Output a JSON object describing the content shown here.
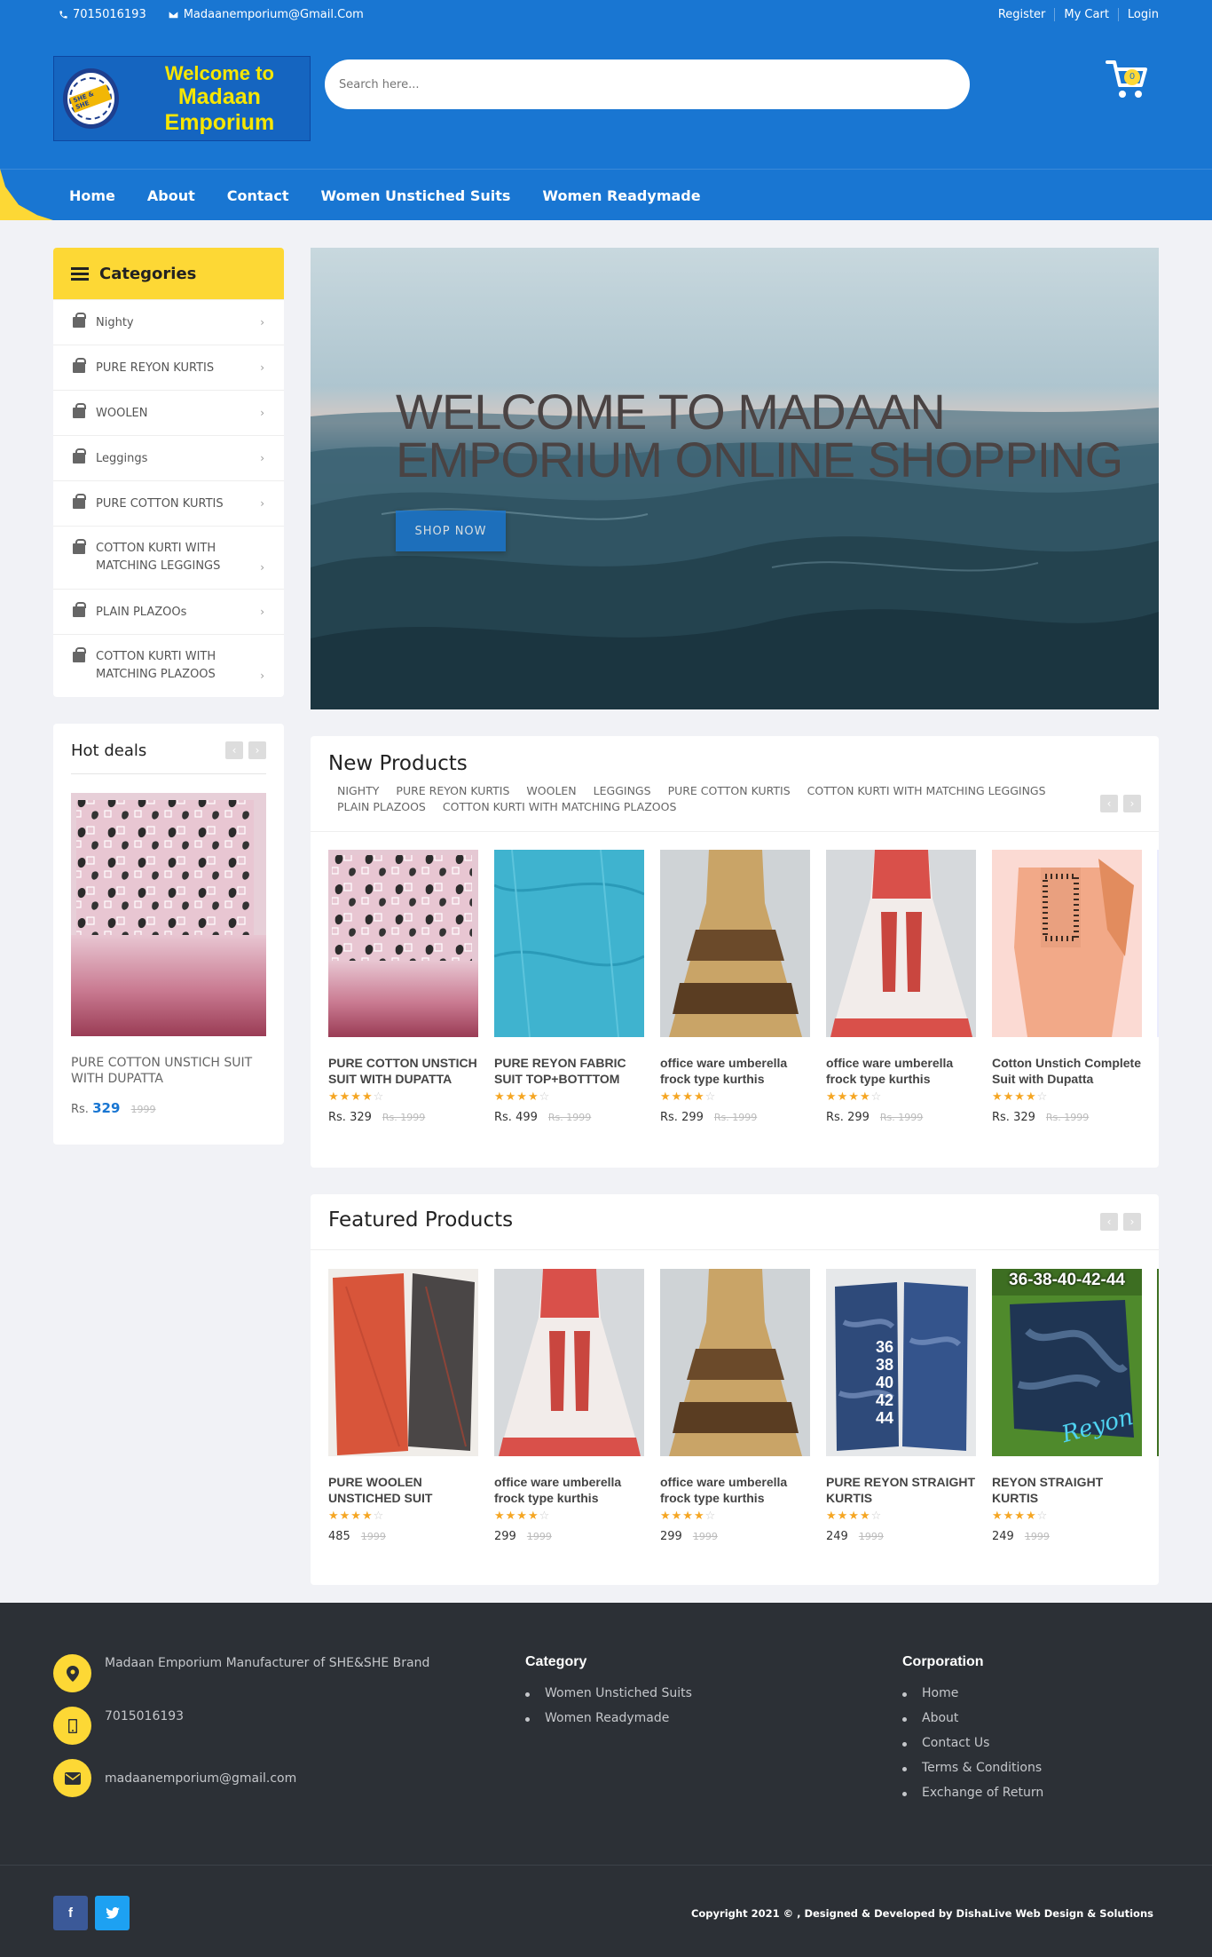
{
  "topbar": {
    "phone": "7015016193",
    "email": "Madaanemporium@Gmail.Com",
    "links": [
      "Register",
      "My Cart",
      "Login"
    ]
  },
  "logo": {
    "line1": "Welcome to",
    "line2": "Madaan Emporium",
    "badge_text": "SHE & SHE"
  },
  "search": {
    "placeholder": "Search here..."
  },
  "cart": {
    "count": "0"
  },
  "nav": {
    "items": [
      "Home",
      "About",
      "Contact",
      "Women Unstiched Suits",
      "Women Readymade"
    ]
  },
  "colors": {
    "primary": "#1976d2",
    "accent": "#fdd835",
    "footer": "#2c3036"
  },
  "categories": {
    "title": "Categories",
    "items": [
      "Nighty",
      "PURE REYON KURTIS",
      "WOOLEN",
      "Leggings",
      "PURE COTTON KURTIS",
      "COTTON KURTI WITH MATCHING LEGGINGS",
      "PLAIN PLAZOOs",
      "COTTON KURTI WITH MATCHING PLAZOOS"
    ]
  },
  "hot_deals": {
    "title": "Hot deals",
    "product": {
      "name": "PURE COTTON UNSTICH SUIT WITH DUPATTA",
      "currency": "Rs.",
      "price": "329",
      "old_price": "1999"
    }
  },
  "hero": {
    "title": "WELCOME TO MADAAN EMPORIUM ONLINE SHOPPING",
    "button": "SHOP NOW"
  },
  "new_products": {
    "title": "New Products",
    "tabs": [
      "NIGHTY",
      "PURE REYON KURTIS",
      "WOOLEN",
      "LEGGINGS",
      "PURE COTTON KURTIS",
      "COTTON KURTI WITH MATCHING LEGGINGS",
      "PLAIN PLAZOOS",
      "COTTON KURTI WITH MATCHING PLAZOOS"
    ],
    "items": [
      {
        "name": "PURE COTTON UNSTICH SUIT WITH DUPATTA",
        "price": "Rs. 329",
        "old_price": "Rs. 1999",
        "rating": 4
      },
      {
        "name": "PURE REYON FABRIC SUIT TOP+BOTTTOM",
        "price": "Rs. 499",
        "old_price": "Rs. 1999",
        "rating": 4
      },
      {
        "name": "office ware umberella frock type kurthis",
        "price": "Rs. 299",
        "old_price": "Rs. 1999",
        "rating": 4
      },
      {
        "name": "office ware umberella frock type kurthis",
        "price": "Rs. 299",
        "old_price": "Rs. 1999",
        "rating": 4
      },
      {
        "name": "Cotton Unstich Complete Suit with Dupatta",
        "price": "Rs. 329",
        "old_price": "Rs. 1999",
        "rating": 4
      }
    ]
  },
  "featured_products": {
    "title": "Featured Products",
    "items": [
      {
        "name": "PURE WOOLEN UNSTICHED SUIT",
        "price": "485",
        "old_price": "1999",
        "rating": 4
      },
      {
        "name": "office ware umberella frock type kurthis",
        "price": "299",
        "old_price": "1999",
        "rating": 4
      },
      {
        "name": "office ware umberella frock type kurthis",
        "price": "299",
        "old_price": "1999",
        "rating": 4
      },
      {
        "name": "PURE REYON STRAIGHT KURTIS",
        "price": "249",
        "old_price": "1999",
        "rating": 4,
        "overlay": "36\n38\n40\n42\n44"
      },
      {
        "name": "REYON STRAIGHT KURTIS",
        "price": "249",
        "old_price": "1999",
        "rating": 4,
        "overlay_top": "36-38-40-42-44",
        "overlay_script": "Reyon"
      }
    ]
  },
  "footer": {
    "address": "Madaan Emporium Manufacturer of SHE&SHE Brand",
    "phone": "7015016193",
    "email": "madaanemporium@gmail.com",
    "category": {
      "title": "Category",
      "links": [
        "Women Unstiched Suits",
        "Women Readymade"
      ]
    },
    "corporation": {
      "title": "Corporation",
      "links": [
        "Home",
        "About",
        "Contact Us",
        "Terms & Conditions",
        "Exchange of Return"
      ]
    },
    "social": [
      "facebook-icon",
      "twitter-icon"
    ],
    "copyright": "Copyright 2021 © , Designed & Developed by DishaLive Web Design & Solutions"
  }
}
